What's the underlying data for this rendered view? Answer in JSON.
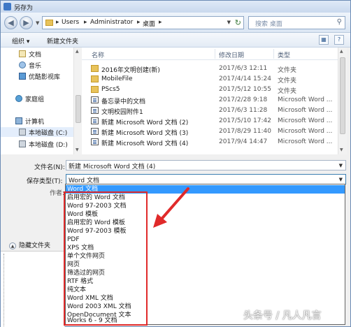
{
  "window": {
    "title": "另存为"
  },
  "address": {
    "crumbs": [
      "Users",
      "Administrator",
      "桌面"
    ],
    "search_placeholder": "搜索 桌面"
  },
  "toolbar": {
    "organize": "组织 ▾",
    "new_folder": "新建文件夹"
  },
  "nav_pane": {
    "items": [
      {
        "label": "文档",
        "icon": "documents-icon"
      },
      {
        "label": "音乐",
        "icon": "music-icon"
      },
      {
        "label": "优酷影视库",
        "icon": "video-library-icon"
      },
      {
        "label": "家庭组",
        "icon": "homegroup-icon"
      },
      {
        "label": "计算机",
        "icon": "computer-icon"
      },
      {
        "label": "本地磁盘 (C:)",
        "icon": "drive-icon"
      },
      {
        "label": "本地磁盘 (D:)",
        "icon": "drive-icon"
      }
    ]
  },
  "file_list": {
    "columns": [
      "名称",
      "修改日期",
      "类型"
    ],
    "rows": [
      {
        "name": "2016年文明创建(新)",
        "date": "2017/6/3 12:11",
        "type": "文件夹",
        "kind": "folder"
      },
      {
        "name": "MobileFile",
        "date": "2017/4/14 15:24",
        "type": "文件夹",
        "kind": "folder"
      },
      {
        "name": "PScs5",
        "date": "2017/5/12 10:55",
        "type": "文件夹",
        "kind": "folder"
      },
      {
        "name": "备忘录中的文档",
        "date": "2017/2/28 9:18",
        "type": "Microsoft Word ...",
        "kind": "doc"
      },
      {
        "name": "文明校园附件1",
        "date": "2017/6/3 11:28",
        "type": "Microsoft Word ...",
        "kind": "doc"
      },
      {
        "name": "新建 Microsoft Word 文档 (2)",
        "date": "2017/5/10 17:42",
        "type": "Microsoft Word ...",
        "kind": "doc"
      },
      {
        "name": "新建 Microsoft Word 文档 (3)",
        "date": "2017/8/29 11:40",
        "type": "Microsoft Word ...",
        "kind": "doc"
      },
      {
        "name": "新建 Microsoft Word 文档 (4)",
        "date": "2017/9/4 14:47",
        "type": "Microsoft Word ...",
        "kind": "doc"
      }
    ]
  },
  "form": {
    "filename_label": "文件名(N):",
    "filename_value": "新建 Microsoft Word 文档 (4)",
    "filetype_label": "保存类型(T):",
    "filetype_value": "Word 文档",
    "author_label": "作者:"
  },
  "dropdown": {
    "options": [
      "Word 文档",
      "启用宏的 Word 文档",
      "Word 97-2003 文档",
      "Word 模板",
      "启用宏的 Word 模板",
      "Word 97-2003 模板",
      "PDF",
      "XPS 文档",
      "单个文件网页",
      "网页",
      "筛选过的网页",
      "RTF 格式",
      "纯文本",
      "Word XML 文档",
      "Word 2003 XML 文档",
      "OpenDocument 文本",
      "Works 6 - 9 文档"
    ],
    "selected_index": 0
  },
  "hide_folders": "隐藏文件夹",
  "watermark": "头条号 / 凡人凡言",
  "colors": {
    "selection": "#3399ff",
    "highlight_box": "#e02a2a",
    "folder": "#e8c35a"
  }
}
